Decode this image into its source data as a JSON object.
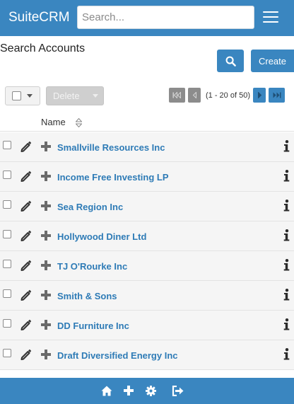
{
  "header": {
    "brand": "SuiteCRM",
    "search_placeholder": "Search...",
    "menu_icon": "hamburger-icon"
  },
  "page": {
    "title": "Search Accounts",
    "search_button_icon": "search-icon",
    "create_label": "Create"
  },
  "toolbar": {
    "bulk_select_icon": "checkbox-icon",
    "delete_label": "Delete",
    "pagination": {
      "info": "(1 - 20 of 50)",
      "first_icon": "first-page-icon",
      "prev_icon": "previous-page-icon",
      "next_icon": "next-page-icon",
      "last_icon": "last-page-icon"
    }
  },
  "table": {
    "column_name": "Name",
    "sort_icon": "sort-icon",
    "rows": [
      {
        "name": "Smallville Resources Inc"
      },
      {
        "name": "Income Free Investing LP"
      },
      {
        "name": "Sea Region Inc"
      },
      {
        "name": "Hollywood Diner Ltd"
      },
      {
        "name": "TJ O'Rourke Inc"
      },
      {
        "name": "Smith & Sons"
      },
      {
        "name": "DD Furniture Inc"
      },
      {
        "name": "Draft Diversified Energy Inc"
      }
    ]
  },
  "footer": {
    "icons": [
      "home-icon",
      "plus-icon",
      "gear-icon",
      "logout-icon"
    ]
  },
  "colors": {
    "brand_blue": "#3a86c0",
    "link_blue": "#2e7bb6",
    "row_bg": "#f5f5f5",
    "disabled_gray": "#cfcfcf",
    "pager_gray": "#8c8c8c"
  }
}
